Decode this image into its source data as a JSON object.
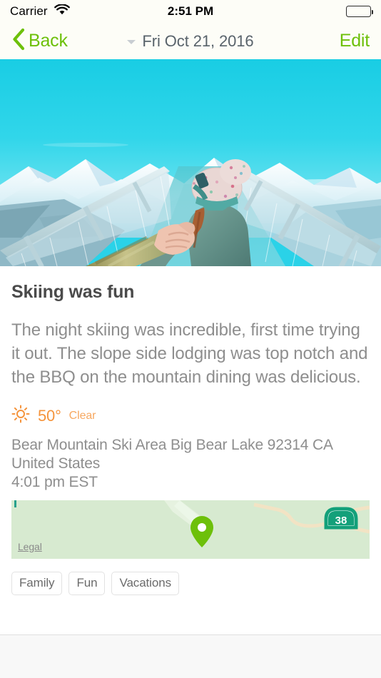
{
  "status_bar": {
    "carrier": "Carrier",
    "wifi_icon": "wifi-icon",
    "time": "2:51 PM",
    "battery_icon": "battery-full-icon"
  },
  "nav_bar": {
    "back_label": "Back",
    "back_icon": "chevron-left-icon",
    "title": "Fri Oct 21, 2016",
    "title_caret_icon": "caret-down-icon",
    "edit_label": "Edit",
    "accent_color": "#6dc00a",
    "background_color": "#fdfdf7",
    "title_color": "#59636b"
  },
  "hero": {
    "photo_alt": "Person in teal winter jacket and pom-pom beanie on a snowy glass skywalk bridge reaching back to hold a hand, snow-capped mountains and cyan sky",
    "sky_color": "#2ad2e8"
  },
  "entry": {
    "title": "Skiing was fun",
    "body": "The night skiing was incredible, first time trying it out. The slope side lodging was top notch and the BBQ on the mountain dining was delicious.",
    "title_color": "#4a4a4a",
    "body_color": "#8e8e8e"
  },
  "weather": {
    "icon": "sun-clear-icon",
    "temperature": "50°",
    "condition": "Clear",
    "color": "#f5943c"
  },
  "location": {
    "address": "Bear Mountain Ski Area Big Bear Lake 92314 CA United States",
    "time": "4:01 pm EST"
  },
  "map": {
    "legal_label": "Legal",
    "pin_icon": "map-pin-icon",
    "pin_color": "#6dc00a",
    "background_color": "#d7ead0",
    "highway_shield_label": "38",
    "highway_shield_color": "#13a07a",
    "road_color": "#f2e3c4"
  },
  "tags": [
    {
      "label": "Family"
    },
    {
      "label": "Fun"
    },
    {
      "label": "Vacations"
    }
  ]
}
